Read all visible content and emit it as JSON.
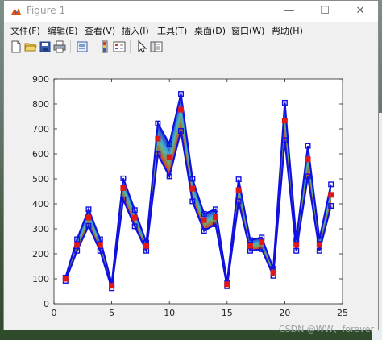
{
  "window": {
    "title": "Figure 1",
    "minimize_glyph": "—",
    "maximize_glyph": "☐",
    "close_glyph": "✕"
  },
  "menu": {
    "items": [
      {
        "label": "文件(F)"
      },
      {
        "label": "编辑(E)"
      },
      {
        "label": "查看(V)"
      },
      {
        "label": "插入(I)"
      },
      {
        "label": "工具(T)"
      },
      {
        "label": "桌面(D)"
      },
      {
        "label": "窗口(W)"
      },
      {
        "label": "帮助(H)"
      }
    ]
  },
  "toolbar": {
    "icons": [
      "new-file-icon",
      "open-folder-icon",
      "save-icon",
      "print-icon",
      "print-preview-icon",
      "colorbar-icon",
      "legend-icon",
      "pointer-icon",
      "property-editor-icon"
    ]
  },
  "watermark": "CSDN @WW、forever",
  "colors": {
    "axes_bg": "#ffffff",
    "band_colors": [
      "#1f3bd6",
      "#2a6bd0",
      "#3a9ad0",
      "#4ab0b0",
      "#6ea060",
      "#a0703a",
      "#d03a2a"
    ],
    "top_line": "#1010e0",
    "center_marker": "#e01818"
  },
  "chart_data": {
    "type": "line",
    "title": "",
    "xlabel": "",
    "ylabel": "",
    "xlim": [
      0,
      25
    ],
    "ylim": [
      0,
      900
    ],
    "xticks": [
      0,
      5,
      10,
      15,
      20,
      25
    ],
    "yticks": [
      0,
      100,
      200,
      300,
      400,
      500,
      600,
      700,
      800,
      900
    ],
    "x": [
      1,
      2,
      3,
      4,
      5,
      6,
      7,
      8,
      9,
      10,
      11,
      12,
      13,
      14,
      15,
      16,
      17,
      18,
      19,
      20,
      21,
      22,
      23,
      24
    ],
    "series": [
      {
        "values": [
          105,
          258,
          378,
          258,
          80,
          502,
          375,
          245,
          722,
          640,
          840,
          500,
          360,
          378,
          85,
          498,
          255,
          265,
          140,
          805,
          255,
          632,
          258,
          478
        ]
      },
      {
        "values": [
          100,
          236,
          345,
          236,
          72,
          463,
          345,
          232,
          661,
          587,
          777,
          461,
          335,
          347,
          78,
          455,
          232,
          246,
          125,
          733,
          236,
          578,
          236,
          436
        ]
      },
      {
        "values": [
          92,
          212,
          312,
          212,
          62,
          418,
          310,
          212,
          598,
          510,
          692,
          410,
          292,
          318,
          70,
          410,
          212,
          218,
          112,
          655,
          212,
          510,
          212,
          392
        ]
      }
    ]
  }
}
